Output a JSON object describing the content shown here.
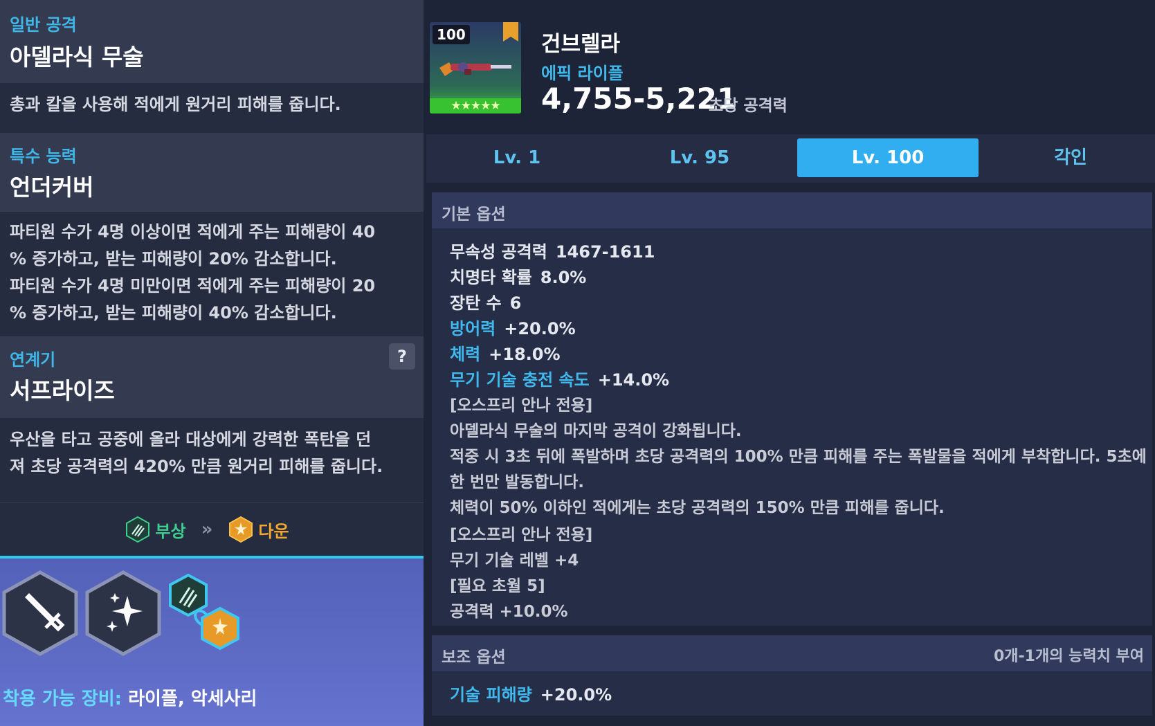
{
  "left": {
    "sections": [
      {
        "category": "일반 공격",
        "name": "아델라식 무술",
        "description_lines": [
          "총과 칼을 사용해 적에게 원거리 피해를 줍니다."
        ]
      },
      {
        "category": "특수 능력",
        "name": "언더커버",
        "description_lines": [
          "파티원 수가 4명 이상이면 적에게 주는 피해량이 40",
          "% 증가하고, 받는 피해량이 20% 감소합니다.",
          "파티원 수가 4명 미만이면 적에게 주는 피해량이 20",
          "% 증가하고, 받는 피해량이 40% 감소합니다."
        ]
      },
      {
        "category": "연계기",
        "name": "서프라이즈",
        "description_lines": [
          "우산을 타고 공중에 올라 대상에게 강력한 폭탄을 던",
          "져 초당 공격력의 420% 만큼 원거리 피해를 줍니다."
        ]
      }
    ],
    "help_label": "?",
    "chain": {
      "from_label": "부상",
      "to_label": "다운",
      "arrow": "»"
    },
    "equip": {
      "key": "착용 가능 장비:",
      "value": "라이플, 악세사리"
    }
  },
  "weapon": {
    "level_badge": "100",
    "stars": "★★★★★",
    "name": "건브렐라",
    "type": "에픽 라이플",
    "dps": "4,755-5,221",
    "dps_label": "초당 공격력"
  },
  "tabs": [
    {
      "label": "Lv. 1",
      "active": false
    },
    {
      "label": "Lv. 95",
      "active": false
    },
    {
      "label": "Lv. 100",
      "active": true
    },
    {
      "label": "각인",
      "active": false
    }
  ],
  "basic_options": {
    "title": "기본 옵션",
    "stats": [
      {
        "key": "무속성 공격력",
        "value": "1467-1611",
        "highlight": false
      },
      {
        "key": "치명타 확률",
        "value": "8.0%",
        "highlight": false
      },
      {
        "key": "장탄 수",
        "value": "6",
        "highlight": false
      },
      {
        "key": "방어력",
        "value": "+20.0%",
        "highlight": true
      },
      {
        "key": "체력",
        "value": "+18.0%",
        "highlight": true
      },
      {
        "key": "무기 기술 충전 속도",
        "value": "+14.0%",
        "highlight": true
      }
    ],
    "text_lines": [
      "[오스프리 안나 전용]",
      "아델라식 무술의 마지막 공격이 강화됩니다.",
      "적중 시 3초 뒤에 폭발하며 초당 공격력의 100% 만큼 피해를 주는 폭발물을 적에게 부착합니다. 5초에",
      "한 번만 발동합니다.",
      "체력이 50% 이하인 적에게는 초당 공격력의 150% 만큼 피해를 줍니다.",
      "[오스프리 안나 전용]",
      "무기 기술 레벨 +4",
      "[필요 초월 5]",
      "공격력 +10.0%"
    ]
  },
  "sub_options": {
    "title": "보조 옵션",
    "note": "0개-1개의 능력치 부여",
    "stats": [
      {
        "key": "기술 피해량",
        "value": "+20.0%",
        "highlight": true
      }
    ]
  },
  "colors": {
    "accent": "#3fb7e9",
    "tab_active": "#31aef0",
    "injury": "#3ccf8e",
    "down": "#f0a830"
  }
}
